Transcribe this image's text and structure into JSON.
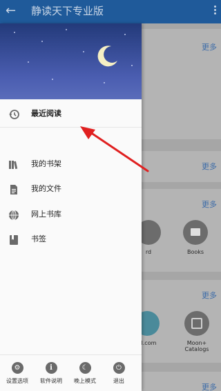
{
  "appbar": {
    "title": "静读天下专业版",
    "back_icon": "arrow-left-icon",
    "menu_icon": "more-vert-icon",
    "color": "#1f5a9a"
  },
  "drawer": {
    "header_icon": "moon-icon",
    "items": [
      {
        "label": "最近阅读",
        "icon": "history-icon"
      },
      {
        "label": "我的书架",
        "icon": "bookshelf-icon"
      },
      {
        "label": "我的文件",
        "icon": "file-icon"
      },
      {
        "label": "网上书库",
        "icon": "globe-icon"
      },
      {
        "label": "书签",
        "icon": "bookmark-icon"
      }
    ],
    "bottom": [
      {
        "label": "设置选项",
        "icon": "gear-icon"
      },
      {
        "label": "软件说明",
        "icon": "info-icon"
      },
      {
        "label": "晚上模式",
        "icon": "night-mode-icon"
      },
      {
        "label": "退出",
        "icon": "power-icon"
      }
    ]
  },
  "main": {
    "more_label": "更多",
    "categories": [
      {
        "label": "rd"
      },
      {
        "label": "Books"
      },
      {
        "label": "el.com"
      },
      {
        "label": "Moon+ Catalogs"
      }
    ]
  },
  "annotation": {
    "arrow_color": "#e02020"
  }
}
